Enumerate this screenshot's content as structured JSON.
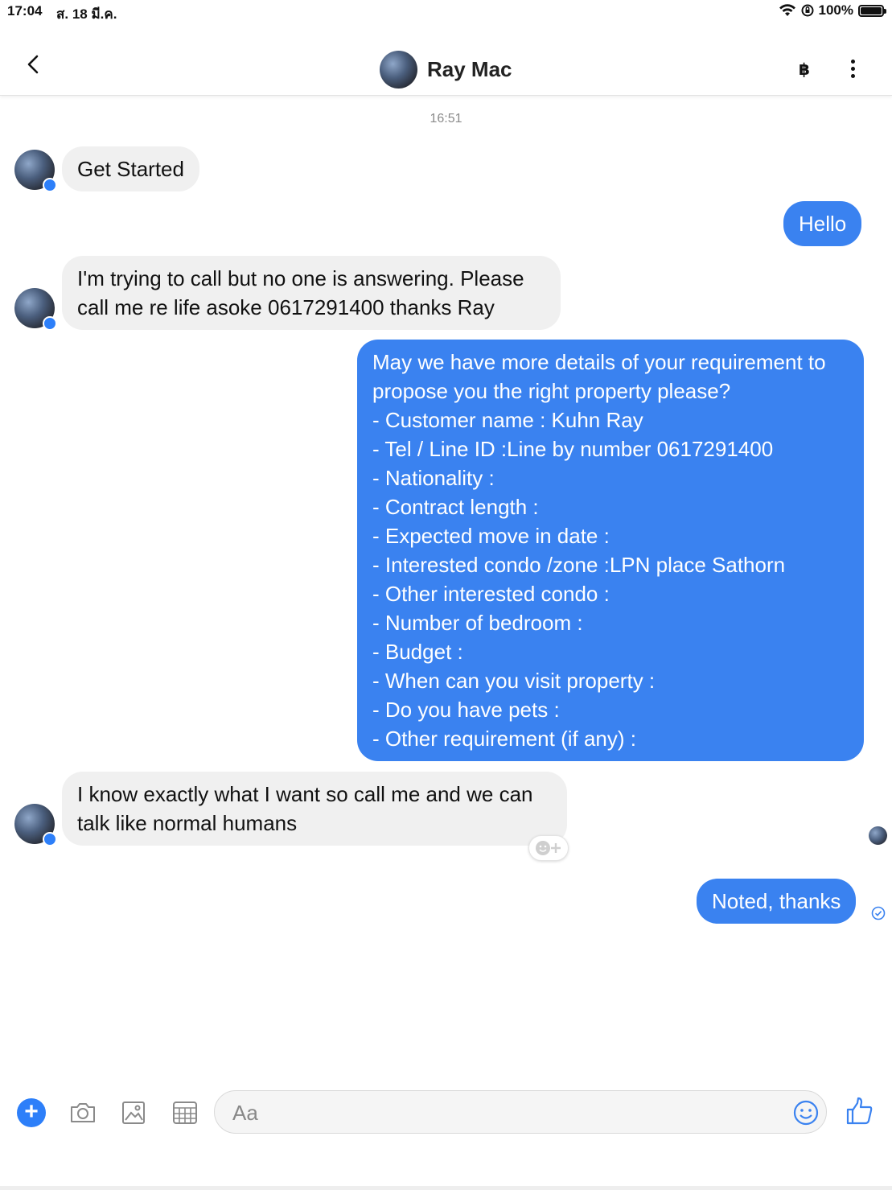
{
  "status_bar": {
    "time": "17:04",
    "date": "ส. 18 มี.ค.",
    "battery": "100%"
  },
  "header": {
    "contact_name": "Ray Mac",
    "currency_symbol": "฿"
  },
  "timestamp": "16:51",
  "messages": [
    {
      "from": "contact",
      "text": "Get Started"
    },
    {
      "from": "me",
      "text": "Hello"
    },
    {
      "from": "contact",
      "text": "I'm trying to call but no one is answering. Please\ncall me re life asoke 0617291400 thanks Ray"
    },
    {
      "from": "me",
      "text": "May we have more details of your requirement to\npropose you the right property please?\n- Customer name : Kuhn Ray\n- Tel / Line ID :Line by number 0617291400\n- Nationality :\n- Contract length :\n- Expected move in date :\n- Interested condo /zone :LPN place Sathorn\n- Other interested condo :\n- Number of bedroom  :\n- Budget :\n- When can you visit property :\n- Do you have pets :\n- Other requirement (if any) :"
    },
    {
      "from": "contact",
      "text": "I know exactly what I want so call me and we can\ntalk like normal humans"
    },
    {
      "from": "me",
      "text": "Noted, thanks"
    }
  ],
  "composer": {
    "placeholder": "Aa"
  },
  "colors": {
    "accent": "#3a82f0",
    "incoming_bubble": "#f0f0f0"
  },
  "icons": [
    "back-arrow-icon",
    "more-options-icon",
    "plus-icon",
    "camera-icon",
    "gallery-icon",
    "sticker-icon",
    "emoji-icon",
    "like-icon",
    "messenger-badge-icon",
    "sent-check-icon"
  ]
}
